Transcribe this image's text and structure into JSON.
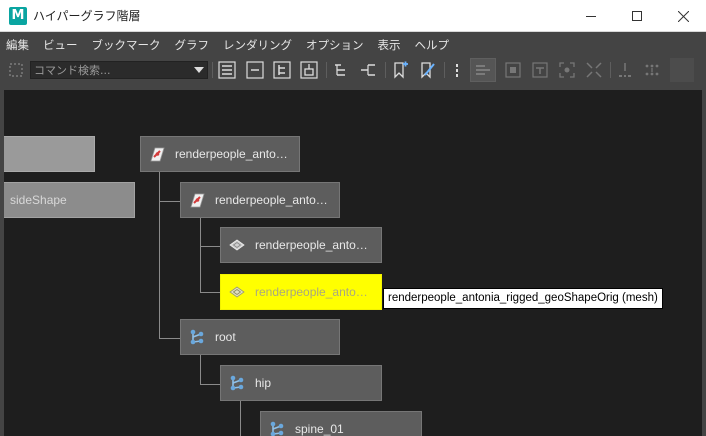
{
  "window": {
    "title": "ハイパーグラフ階層",
    "app_icon_letter": "M",
    "accent": "#0aa5a1"
  },
  "menubar": {
    "items": [
      "編集",
      "ビュー",
      "ブックマーク",
      "グラフ",
      "レンダリング",
      "オプション",
      "表示",
      "ヘルプ"
    ]
  },
  "toolbar": {
    "search_placeholder": "コマンド検索..."
  },
  "graph": {
    "nodes": [
      {
        "label": "",
        "icon": "none"
      },
      {
        "label": "sideShape",
        "icon": "none"
      },
      {
        "label": "renderpeople_anto…",
        "icon": "transform-icon"
      },
      {
        "label": "renderpeople_anto…",
        "icon": "transform-icon"
      },
      {
        "label": "renderpeople_anto…",
        "icon": "mesh-icon"
      },
      {
        "label": "renderpeople_anto…",
        "icon": "mesh-icon",
        "selected": true
      },
      {
        "label": "root",
        "icon": "joint-icon"
      },
      {
        "label": "hip",
        "icon": "joint-icon"
      },
      {
        "label": "spine_01",
        "icon": "joint-icon"
      }
    ],
    "tooltip": "renderpeople_antonia_rigged_geoShapeOrig (mesh)",
    "selection_color": "#ffff00"
  }
}
